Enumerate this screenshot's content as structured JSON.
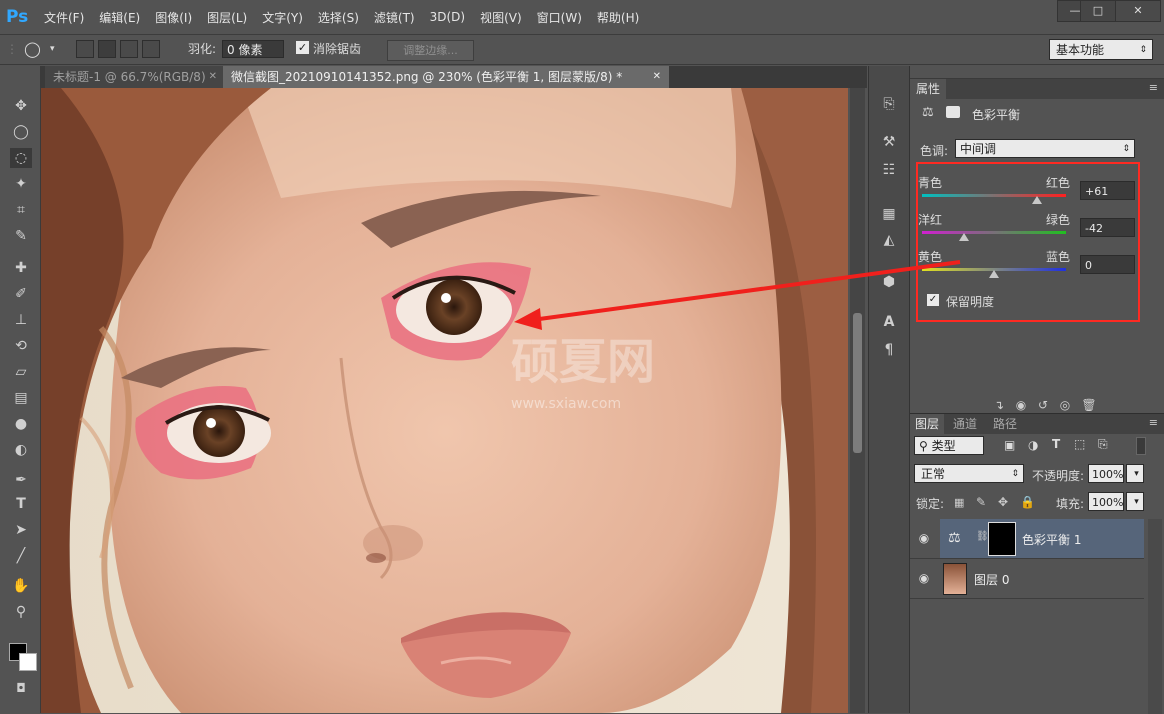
{
  "app": {
    "logo": "Ps"
  },
  "menu": [
    "文件(F)",
    "编辑(E)",
    "图像(I)",
    "图层(L)",
    "文字(Y)",
    "选择(S)",
    "滤镜(T)",
    "3D(D)",
    "视图(V)",
    "窗口(W)",
    "帮助(H)"
  ],
  "window_controls": {
    "minimize": "—",
    "maximize": "□",
    "close": "✕"
  },
  "options": {
    "feather_label": "羽化:",
    "feather_value": "0 像素",
    "antialias_label": "消除锯齿",
    "antialias_checked": true,
    "refine_edge": "调整边缘...",
    "workspace": "基本功能"
  },
  "tabs": [
    {
      "label": "未标题-1 @ 66.7%(RGB/8)",
      "close": "✕",
      "active": false
    },
    {
      "label": "微信截图_20210910141352.png @ 230% (色彩平衡 1, 图层蒙版/8) *",
      "close": "✕",
      "active": true
    }
  ],
  "canvas": {
    "watermark_main": "硕夏网",
    "watermark_url": "www.sxiaw.com"
  },
  "properties": {
    "tab": "属性",
    "panel_title": "色彩平衡",
    "tone_label": "色调:",
    "tone_value": "中间调",
    "sliders": [
      {
        "left": "青色",
        "right": "红色",
        "value": "+61",
        "fraction": 0.8
      },
      {
        "left": "洋红",
        "right": "绿色",
        "value": "-42",
        "fraction": 0.29
      },
      {
        "left": "黄色",
        "right": "蓝色",
        "value": "0",
        "fraction": 0.5
      }
    ],
    "preserve_luminosity": "保留明度",
    "preserve_checked": true
  },
  "layers": {
    "tabs": [
      "图层",
      "通道",
      "路径"
    ],
    "filter": "类型",
    "blend_mode": "正常",
    "opacity_label": "不透明度:",
    "opacity_value": "100%",
    "lock_label": "锁定:",
    "fill_label": "填充:",
    "fill_value": "100%",
    "items": [
      {
        "name": "色彩平衡 1",
        "selected": true
      },
      {
        "name": "图层 0",
        "selected": false
      }
    ]
  },
  "colors": {
    "accent_highlight": "#ff2a22",
    "selected_layer": "#56657a",
    "ps_blue": "#31a8ff"
  }
}
